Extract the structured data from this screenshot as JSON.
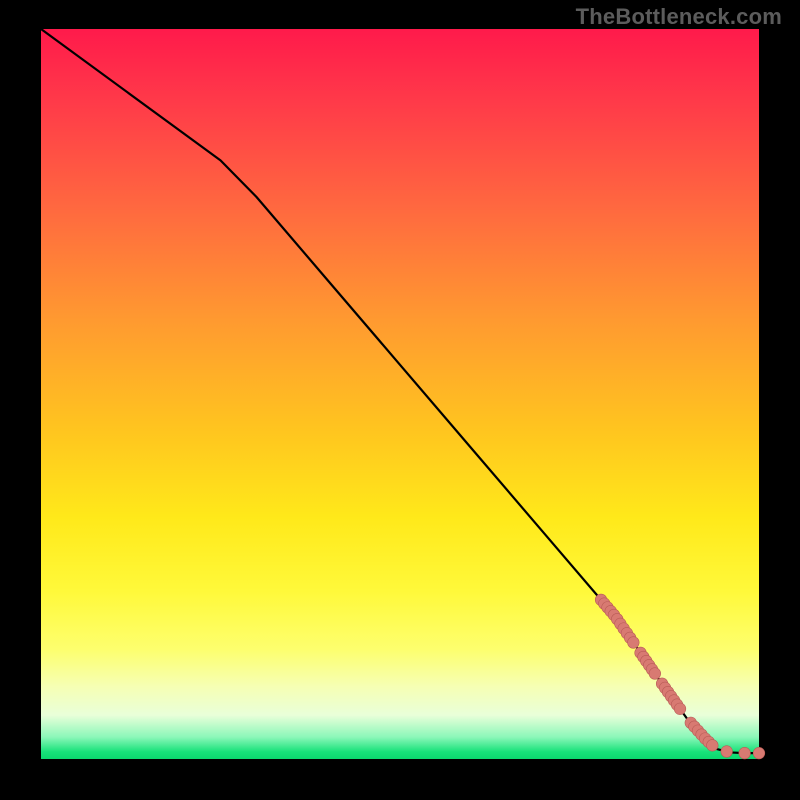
{
  "watermark": "TheBottleneck.com",
  "colors": {
    "curve": "#000000",
    "marker": "#d87a72",
    "marker_stroke": "#b85a55"
  },
  "chart_data": {
    "type": "line",
    "title": "",
    "xlabel": "",
    "ylabel": "",
    "xlim": [
      0,
      100
    ],
    "ylim": [
      0,
      100
    ],
    "curve_xy": [
      [
        0,
        100
      ],
      [
        25,
        82
      ],
      [
        30,
        77
      ],
      [
        40,
        65.5
      ],
      [
        50,
        54
      ],
      [
        60,
        42.5
      ],
      [
        70,
        31
      ],
      [
        80,
        19.5
      ],
      [
        86,
        11
      ],
      [
        90,
        5.5
      ],
      [
        92.5,
        2.8
      ],
      [
        94,
        1.4
      ],
      [
        96,
        0.9
      ],
      [
        98,
        0.8
      ],
      [
        100,
        0.8
      ]
    ],
    "marker_segments_x": [
      [
        78,
        82.5
      ],
      [
        83.5,
        85.5
      ],
      [
        86.5,
        89
      ],
      [
        90.5,
        93.5
      ]
    ],
    "marker_points_x": [
      95.5,
      98,
      100
    ],
    "marker_radius": 5.8
  }
}
